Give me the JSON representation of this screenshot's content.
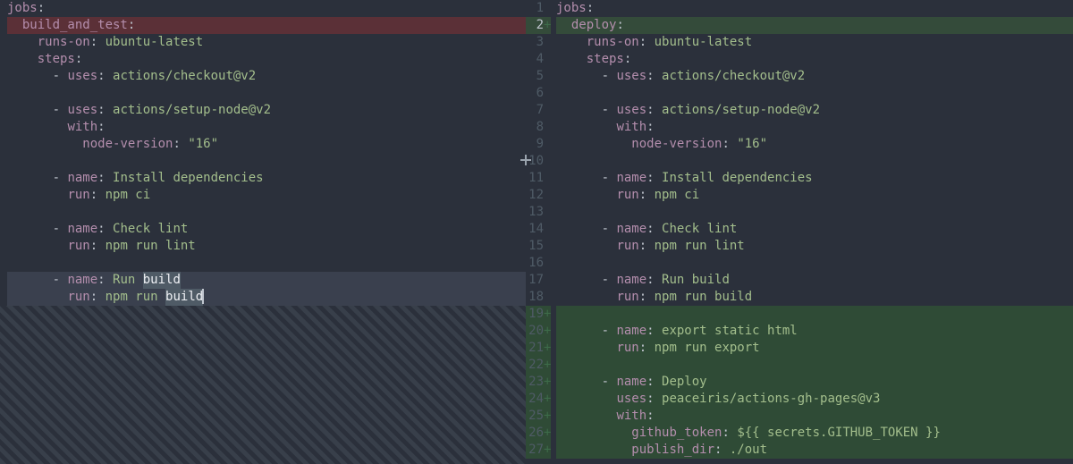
{
  "left": {
    "lines": [
      {
        "type": "plain",
        "segs": [
          [
            "key",
            "jobs"
          ],
          [
            "punc",
            ":"
          ]
        ]
      },
      {
        "type": "del",
        "segs": [
          [
            "plain",
            "  "
          ],
          [
            "key",
            "build_and_test"
          ],
          [
            "punc",
            ":"
          ]
        ]
      },
      {
        "type": "plain",
        "segs": [
          [
            "plain",
            "    "
          ],
          [
            "key",
            "runs-on"
          ],
          [
            "punc",
            ": "
          ],
          [
            "str",
            "ubuntu-latest"
          ]
        ]
      },
      {
        "type": "plain",
        "segs": [
          [
            "plain",
            "    "
          ],
          [
            "key",
            "steps"
          ],
          [
            "punc",
            ":"
          ]
        ]
      },
      {
        "type": "plain",
        "segs": [
          [
            "plain",
            "      "
          ],
          [
            "dash",
            "- "
          ],
          [
            "key",
            "uses"
          ],
          [
            "punc",
            ": "
          ],
          [
            "str",
            "actions/checkout@v2"
          ]
        ]
      },
      {
        "type": "plain",
        "segs": []
      },
      {
        "type": "plain",
        "segs": [
          [
            "plain",
            "      "
          ],
          [
            "dash",
            "- "
          ],
          [
            "key",
            "uses"
          ],
          [
            "punc",
            ": "
          ],
          [
            "str",
            "actions/setup-node@v2"
          ]
        ]
      },
      {
        "type": "plain",
        "segs": [
          [
            "plain",
            "        "
          ],
          [
            "key",
            "with"
          ],
          [
            "punc",
            ":"
          ]
        ]
      },
      {
        "type": "plain",
        "segs": [
          [
            "plain",
            "          "
          ],
          [
            "key",
            "node-version"
          ],
          [
            "punc",
            ": "
          ],
          [
            "str",
            "\"16\""
          ]
        ]
      },
      {
        "type": "plain",
        "segs": []
      },
      {
        "type": "plain",
        "segs": [
          [
            "plain",
            "      "
          ],
          [
            "dash",
            "- "
          ],
          [
            "key",
            "name"
          ],
          [
            "punc",
            ": "
          ],
          [
            "str",
            "Install dependencies"
          ]
        ]
      },
      {
        "type": "plain",
        "segs": [
          [
            "plain",
            "        "
          ],
          [
            "key",
            "run"
          ],
          [
            "punc",
            ": "
          ],
          [
            "str",
            "npm ci"
          ]
        ]
      },
      {
        "type": "plain",
        "segs": []
      },
      {
        "type": "plain",
        "segs": [
          [
            "plain",
            "      "
          ],
          [
            "dash",
            "- "
          ],
          [
            "key",
            "name"
          ],
          [
            "punc",
            ": "
          ],
          [
            "str",
            "Check lint"
          ]
        ]
      },
      {
        "type": "plain",
        "segs": [
          [
            "plain",
            "        "
          ],
          [
            "key",
            "run"
          ],
          [
            "punc",
            ": "
          ],
          [
            "str",
            "npm run lint"
          ]
        ]
      },
      {
        "type": "plain",
        "segs": []
      },
      {
        "type": "highlight",
        "segs": [
          [
            "plain",
            "      "
          ],
          [
            "dash",
            "- "
          ],
          [
            "key",
            "name"
          ],
          [
            "punc",
            ": "
          ],
          [
            "str",
            "Run "
          ],
          [
            "sel",
            "build"
          ]
        ]
      },
      {
        "type": "highlight",
        "segs": [
          [
            "plain",
            "        "
          ],
          [
            "key",
            "run"
          ],
          [
            "punc",
            ": "
          ],
          [
            "str",
            "npm run "
          ],
          [
            "sel",
            "build"
          ],
          [
            "cursor",
            ""
          ]
        ]
      }
    ],
    "hatch_from_row": 18
  },
  "right": {
    "lines": [
      {
        "num": "1",
        "mark": "",
        "type": "plain",
        "segs": [
          [
            "key",
            "jobs"
          ],
          [
            "punc",
            ":"
          ]
        ]
      },
      {
        "num": "2",
        "mark": "+",
        "type": "add-dk",
        "current": true,
        "segs": [
          [
            "plain",
            "  "
          ],
          [
            "key",
            "deploy"
          ],
          [
            "punc",
            ":"
          ]
        ]
      },
      {
        "num": "3",
        "mark": "",
        "type": "plain",
        "segs": [
          [
            "plain",
            "    "
          ],
          [
            "key",
            "runs-on"
          ],
          [
            "punc",
            ": "
          ],
          [
            "str",
            "ubuntu-latest"
          ]
        ]
      },
      {
        "num": "4",
        "mark": "",
        "type": "plain",
        "segs": [
          [
            "plain",
            "    "
          ],
          [
            "key",
            "steps"
          ],
          [
            "punc",
            ":"
          ]
        ]
      },
      {
        "num": "5",
        "mark": "",
        "type": "plain",
        "segs": [
          [
            "plain",
            "      "
          ],
          [
            "dash",
            "- "
          ],
          [
            "key",
            "uses"
          ],
          [
            "punc",
            ": "
          ],
          [
            "str",
            "actions/checkout@v2"
          ]
        ]
      },
      {
        "num": "6",
        "mark": "",
        "type": "plain",
        "segs": []
      },
      {
        "num": "7",
        "mark": "",
        "type": "plain",
        "segs": [
          [
            "plain",
            "      "
          ],
          [
            "dash",
            "- "
          ],
          [
            "key",
            "uses"
          ],
          [
            "punc",
            ": "
          ],
          [
            "str",
            "actions/setup-node@v2"
          ]
        ]
      },
      {
        "num": "8",
        "mark": "",
        "type": "plain",
        "segs": [
          [
            "plain",
            "        "
          ],
          [
            "key",
            "with"
          ],
          [
            "punc",
            ":"
          ]
        ]
      },
      {
        "num": "9",
        "mark": "",
        "type": "plain",
        "segs": [
          [
            "plain",
            "          "
          ],
          [
            "key",
            "node-version"
          ],
          [
            "punc",
            ": "
          ],
          [
            "str",
            "\"16\""
          ]
        ]
      },
      {
        "num": "10",
        "mark": "",
        "type": "plain",
        "segs": []
      },
      {
        "num": "11",
        "mark": "",
        "type": "plain",
        "segs": [
          [
            "plain",
            "      "
          ],
          [
            "dash",
            "- "
          ],
          [
            "key",
            "name"
          ],
          [
            "punc",
            ": "
          ],
          [
            "str",
            "Install dependencies"
          ]
        ]
      },
      {
        "num": "12",
        "mark": "",
        "type": "plain",
        "segs": [
          [
            "plain",
            "        "
          ],
          [
            "key",
            "run"
          ],
          [
            "punc",
            ": "
          ],
          [
            "str",
            "npm ci"
          ]
        ]
      },
      {
        "num": "13",
        "mark": "",
        "type": "plain",
        "segs": []
      },
      {
        "num": "14",
        "mark": "",
        "type": "plain",
        "segs": [
          [
            "plain",
            "      "
          ],
          [
            "dash",
            "- "
          ],
          [
            "key",
            "name"
          ],
          [
            "punc",
            ": "
          ],
          [
            "str",
            "Check lint"
          ]
        ]
      },
      {
        "num": "15",
        "mark": "",
        "type": "plain",
        "segs": [
          [
            "plain",
            "        "
          ],
          [
            "key",
            "run"
          ],
          [
            "punc",
            ": "
          ],
          [
            "str",
            "npm run lint"
          ]
        ]
      },
      {
        "num": "16",
        "mark": "",
        "type": "plain",
        "segs": []
      },
      {
        "num": "17",
        "mark": "",
        "type": "plain",
        "segs": [
          [
            "plain",
            "      "
          ],
          [
            "dash",
            "- "
          ],
          [
            "key",
            "name"
          ],
          [
            "punc",
            ": "
          ],
          [
            "str",
            "Run build"
          ]
        ]
      },
      {
        "num": "18",
        "mark": "",
        "type": "plain",
        "segs": [
          [
            "plain",
            "        "
          ],
          [
            "key",
            "run"
          ],
          [
            "punc",
            ": "
          ],
          [
            "str",
            "npm run build"
          ]
        ]
      },
      {
        "num": "19",
        "mark": "+",
        "type": "add",
        "segs": []
      },
      {
        "num": "20",
        "mark": "+",
        "type": "add",
        "segs": [
          [
            "plain",
            "      "
          ],
          [
            "dash",
            "- "
          ],
          [
            "key",
            "name"
          ],
          [
            "punc",
            ": "
          ],
          [
            "str",
            "export static html"
          ]
        ]
      },
      {
        "num": "21",
        "mark": "+",
        "type": "add",
        "segs": [
          [
            "plain",
            "        "
          ],
          [
            "key",
            "run"
          ],
          [
            "punc",
            ": "
          ],
          [
            "str",
            "npm run export"
          ]
        ]
      },
      {
        "num": "22",
        "mark": "+",
        "type": "add",
        "segs": []
      },
      {
        "num": "23",
        "mark": "+",
        "type": "add",
        "segs": [
          [
            "plain",
            "      "
          ],
          [
            "dash",
            "- "
          ],
          [
            "key",
            "name"
          ],
          [
            "punc",
            ": "
          ],
          [
            "str",
            "Deploy"
          ]
        ]
      },
      {
        "num": "24",
        "mark": "+",
        "type": "add",
        "segs": [
          [
            "plain",
            "        "
          ],
          [
            "key",
            "uses"
          ],
          [
            "punc",
            ": "
          ],
          [
            "str",
            "peaceiris/actions-gh-pages@v3"
          ]
        ]
      },
      {
        "num": "25",
        "mark": "+",
        "type": "add",
        "segs": [
          [
            "plain",
            "        "
          ],
          [
            "key",
            "with"
          ],
          [
            "punc",
            ":"
          ]
        ]
      },
      {
        "num": "26",
        "mark": "+",
        "type": "add",
        "segs": [
          [
            "plain",
            "          "
          ],
          [
            "key",
            "github_token"
          ],
          [
            "punc",
            ": "
          ],
          [
            "str",
            "${{ secrets.GITHUB_TOKEN }}"
          ]
        ]
      },
      {
        "num": "27",
        "mark": "+",
        "type": "add",
        "segs": [
          [
            "plain",
            "          "
          ],
          [
            "key",
            "publish_dir"
          ],
          [
            "punc",
            ": "
          ],
          [
            "str",
            "./out"
          ]
        ]
      }
    ]
  },
  "plus_handle_row": 10
}
